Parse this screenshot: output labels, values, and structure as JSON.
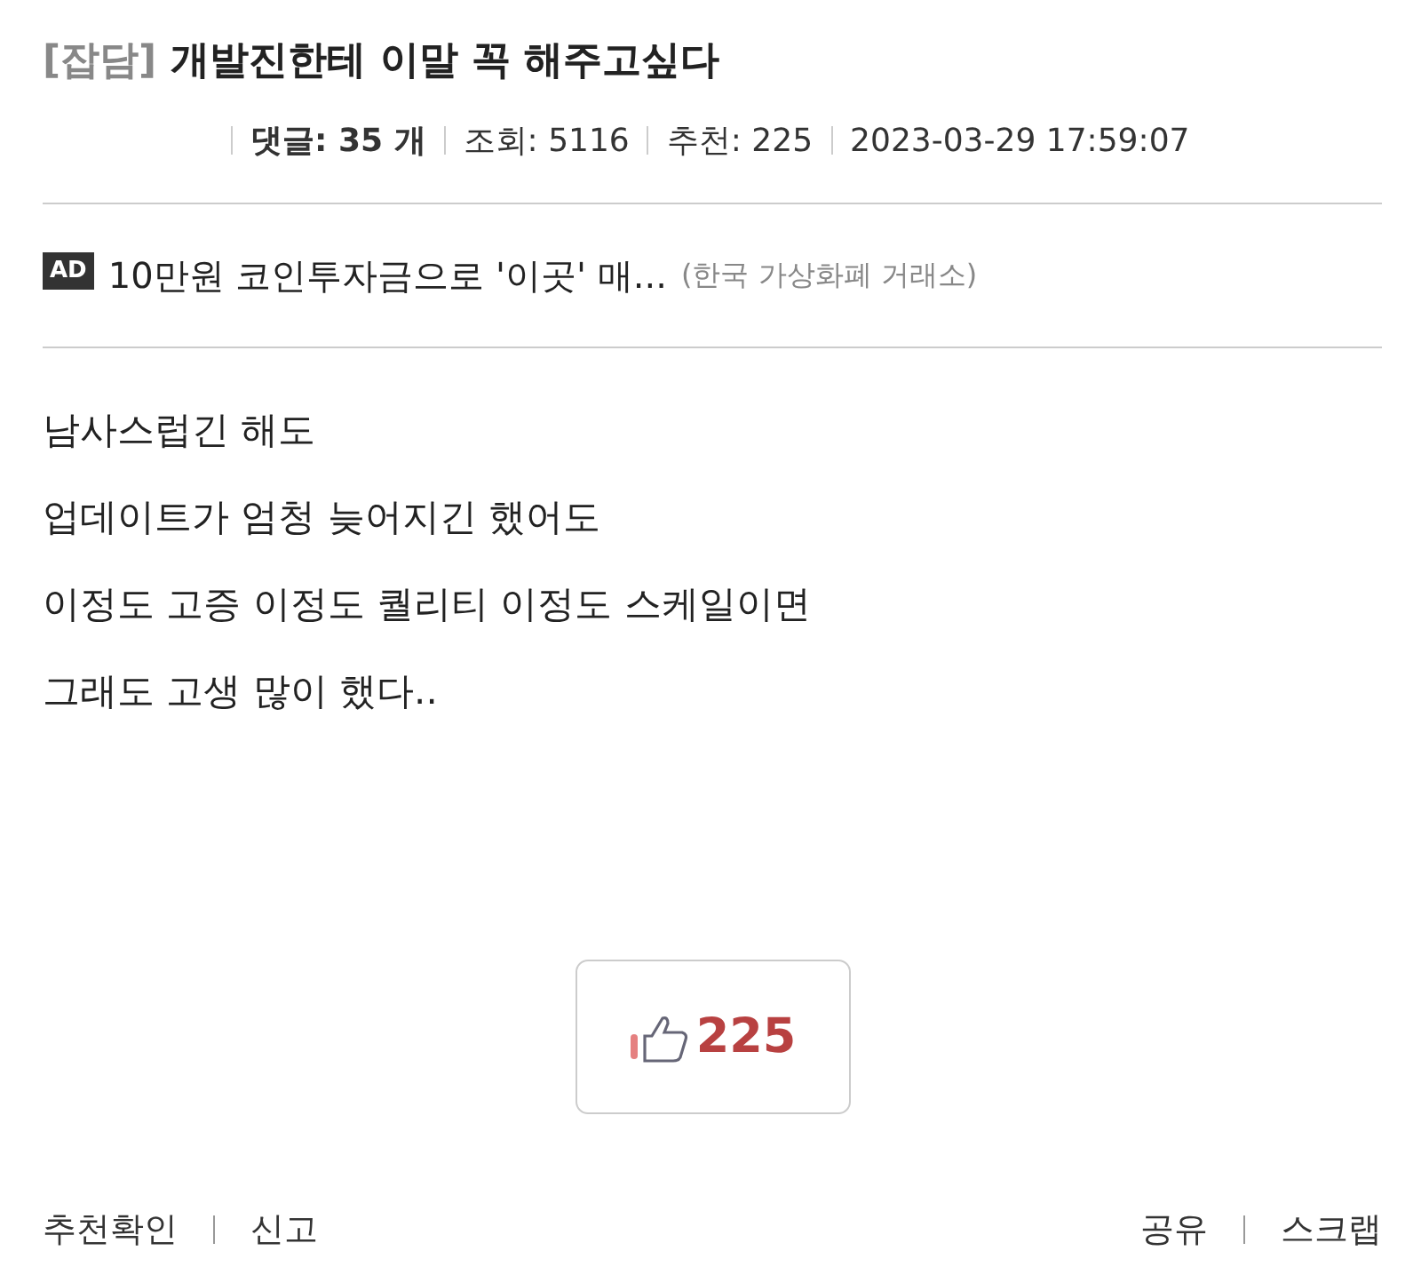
{
  "post": {
    "category": "[잡담]",
    "title": "개발진한테 이말 꼭 해주고싶다"
  },
  "meta": [
    {
      "text": "댓글: 35 개",
      "bold": true
    },
    {
      "text": "조회: 5116",
      "bold": false
    },
    {
      "text": "추천: 225",
      "bold": false
    },
    {
      "text": "2023-03-29 17:59:07",
      "bold": false
    }
  ],
  "ad": {
    "badge": "AD",
    "text": "10만원 코인투자금으로 '이곳' 매...",
    "source": "(한국 가상화폐 거래소)"
  },
  "body": [
    "남사스럽긴 해도",
    "업데이트가 엄청 늦어지긴 했어도",
    "이정도 고증 이정도 퀄리티 이정도 스케일이면",
    "그래도 고생 많이 했다.."
  ],
  "like": {
    "count": "225"
  },
  "footer": {
    "left": [
      "추천확인",
      "신고"
    ],
    "right": [
      "공유",
      "스크랩"
    ]
  }
}
